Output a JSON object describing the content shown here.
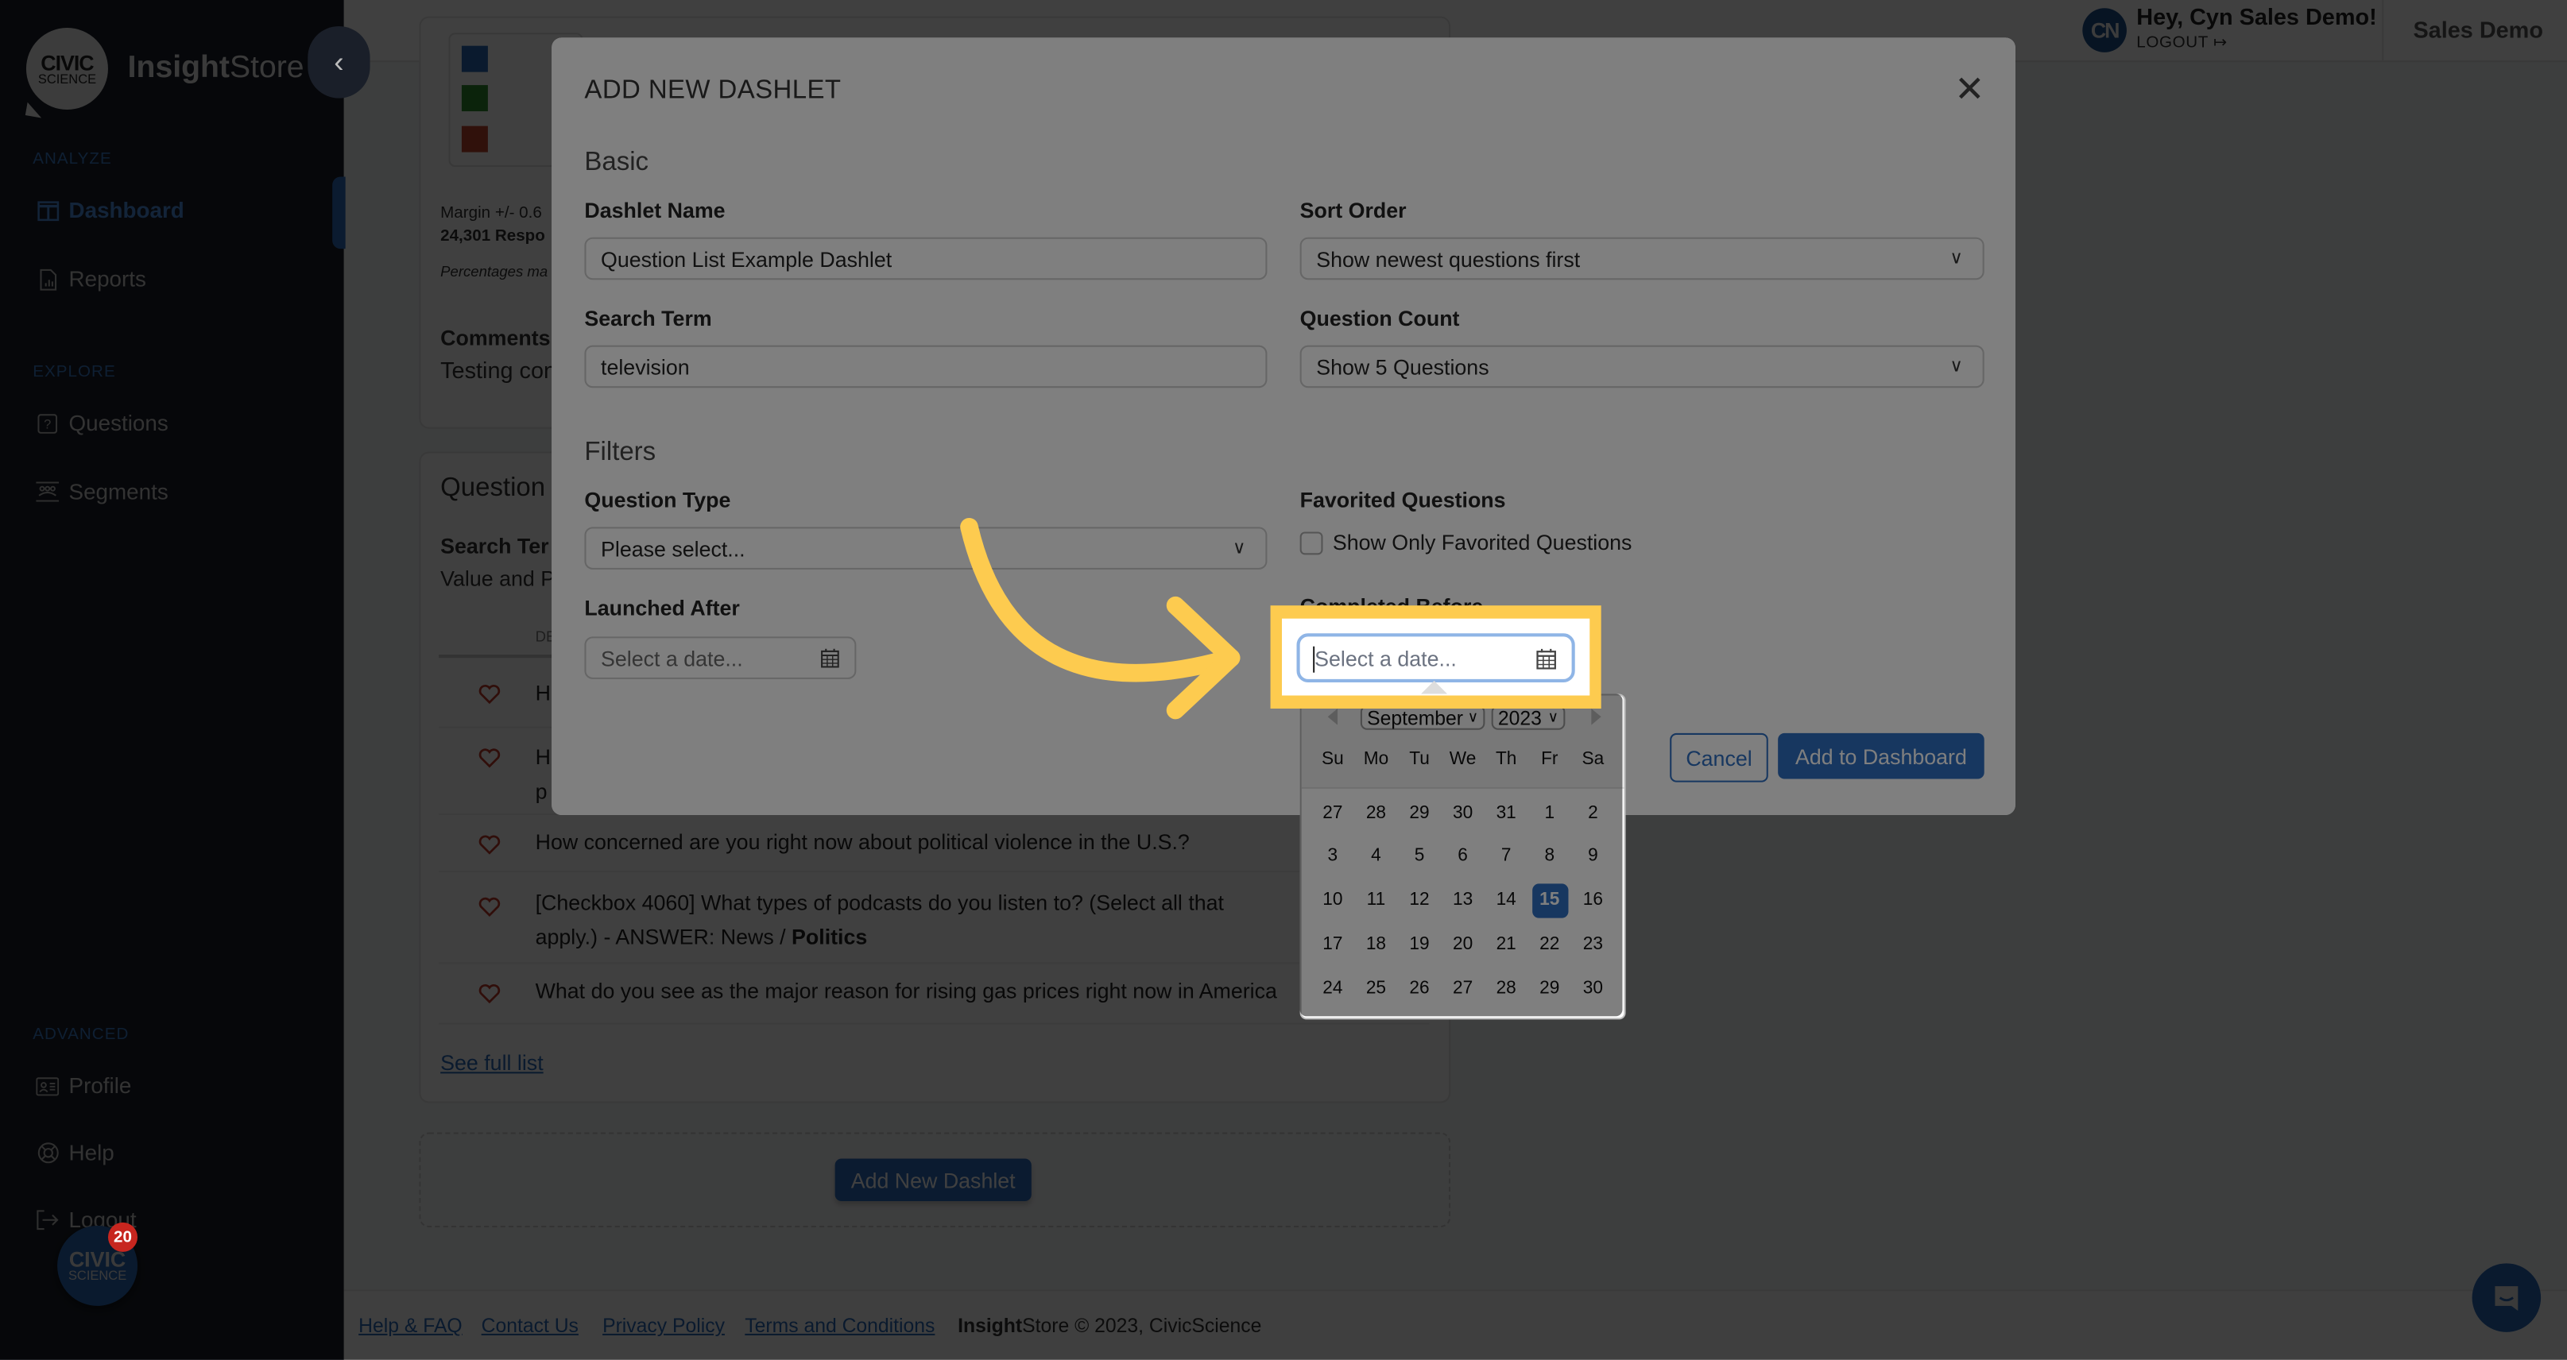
{
  "app": {
    "brand_bold": "Insight",
    "brand_light": "Store",
    "logo_line1": "CIVIC",
    "logo_line2": "SCIENCE"
  },
  "sidebar": {
    "sections": [
      {
        "label": "ANALYZE",
        "items": [
          {
            "label": "Dashboard",
            "icon": "dashboard-icon",
            "active": true
          },
          {
            "label": "Reports",
            "icon": "report-icon",
            "active": false
          }
        ]
      },
      {
        "label": "EXPLORE",
        "items": [
          {
            "label": "Questions",
            "icon": "question-icon",
            "active": false
          },
          {
            "label": "Segments",
            "icon": "segments-icon",
            "active": false
          }
        ]
      },
      {
        "label": "ADVANCED",
        "items": [
          {
            "label": "Profile",
            "icon": "profile-card-icon",
            "active": false
          },
          {
            "label": "Help",
            "icon": "lifebuoy-icon",
            "active": false
          },
          {
            "label": "Logout",
            "icon": "logout-icon",
            "active": false
          }
        ]
      }
    ],
    "fab": {
      "line1": "CIVIC",
      "line2": "SCIENCE",
      "badge": "20"
    }
  },
  "topbar": {
    "avatar_initials": "CN",
    "greeting": "Hey, Cyn Sales Demo!",
    "logout_label": "LOGOUT",
    "account_name": "Sales Demo"
  },
  "background": {
    "legend_colors": [
      "#2b69b7",
      "#2d8a2d",
      "#c0462f"
    ],
    "margin_text": "Margin +/- 0.6",
    "responses_text": "24,301 Respo",
    "percentages_text": "Percentages ma",
    "comments_title": "Comments",
    "comments_text": "Testing con",
    "question_card_title": "Question",
    "search_term_label": "Search Ter",
    "value_text": "Value and P",
    "col_header": "DE",
    "questions": [
      {
        "text": "H",
        "line2": ""
      },
      {
        "text": "H",
        "line2": "p"
      },
      {
        "text": "How concerned are you right now about political violence in the U.S.?",
        "line2": ""
      },
      {
        "text": "[Checkbox 4060] What types of podcasts do you listen to? (Select all that",
        "line2_pre": "apply.) - ANSWER: News / ",
        "line2_bold": "Politics"
      },
      {
        "text": "What do you see as the major reason for rising gas prices right now in America",
        "line2": ""
      }
    ],
    "see_full_list": "See full list",
    "add_new_dashlet": "Add New Dashlet"
  },
  "footer": {
    "links": [
      "Help & FAQ",
      "Contact Us",
      "Privacy Policy",
      "Terms and Conditions"
    ],
    "copyright_bold": "Insight",
    "copyright_rest": "Store © 2023, CivicScience"
  },
  "modal": {
    "title": "ADD NEW DASHLET",
    "basic_section": "Basic",
    "filters_section": "Filters",
    "dashlet_name": {
      "label": "Dashlet Name",
      "value": "Question List Example Dashlet"
    },
    "sort_order": {
      "label": "Sort Order",
      "value": "Show newest questions first"
    },
    "search_term": {
      "label": "Search Term",
      "value": "television"
    },
    "question_count": {
      "label": "Question Count",
      "value": "Show 5 Questions"
    },
    "question_type": {
      "label": "Question Type",
      "value": "Please select..."
    },
    "favorited": {
      "label": "Favorited Questions",
      "checkbox_label": "Show Only Favorited Questions",
      "checked": false
    },
    "launched_after": {
      "label": "Launched After",
      "placeholder": "Select a date..."
    },
    "completed_before": {
      "label": "Completed Before",
      "placeholder": "Select a date..."
    },
    "cancel_label": "Cancel",
    "add_label": "Add to Dashboard"
  },
  "datepicker": {
    "month": "September",
    "year": "2023",
    "weekdays": [
      "Su",
      "Mo",
      "Tu",
      "We",
      "Th",
      "Fr",
      "Sa"
    ],
    "weeks": [
      [
        "27",
        "28",
        "29",
        "30",
        "31",
        "1",
        "2"
      ],
      [
        "3",
        "4",
        "5",
        "6",
        "7",
        "8",
        "9"
      ],
      [
        "10",
        "11",
        "12",
        "13",
        "14",
        "15",
        "16"
      ],
      [
        "17",
        "18",
        "19",
        "20",
        "21",
        "22",
        "23"
      ],
      [
        "24",
        "25",
        "26",
        "27",
        "28",
        "29",
        "30"
      ]
    ],
    "selected": "15"
  },
  "annotation": {
    "color": "#fdcb4f"
  }
}
